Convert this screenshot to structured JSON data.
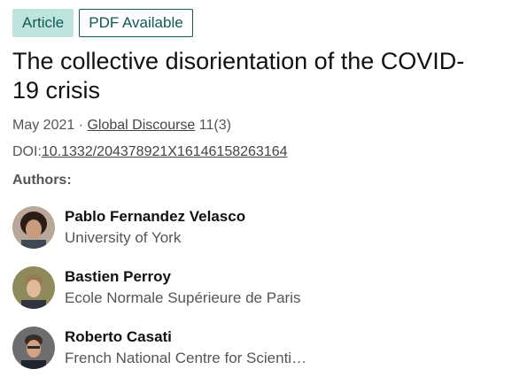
{
  "badges": {
    "article": "Article",
    "pdf": "PDF Available"
  },
  "title": "The collective disorientation of the COVID-19 crisis",
  "meta": {
    "date": "May 2021 · ",
    "journal": "Global Discourse",
    "issue": " 11(3)"
  },
  "doi": {
    "label": "DOI:",
    "value": "10.1332/204378921X16146158263164"
  },
  "authors_label": "Authors:",
  "authors": [
    {
      "name": "Pablo Fernandez Velasco",
      "affiliation": "University of York"
    },
    {
      "name": "Bastien Perroy",
      "affiliation": "Ecole Normale Supérieure de Paris"
    },
    {
      "name": "Roberto Casati",
      "affiliation": "French National Centre for Scientific Research"
    }
  ],
  "colors": {
    "accent": "#0e5a54",
    "badge_bg": "#bfe3dd",
    "muted_text": "#555555"
  }
}
